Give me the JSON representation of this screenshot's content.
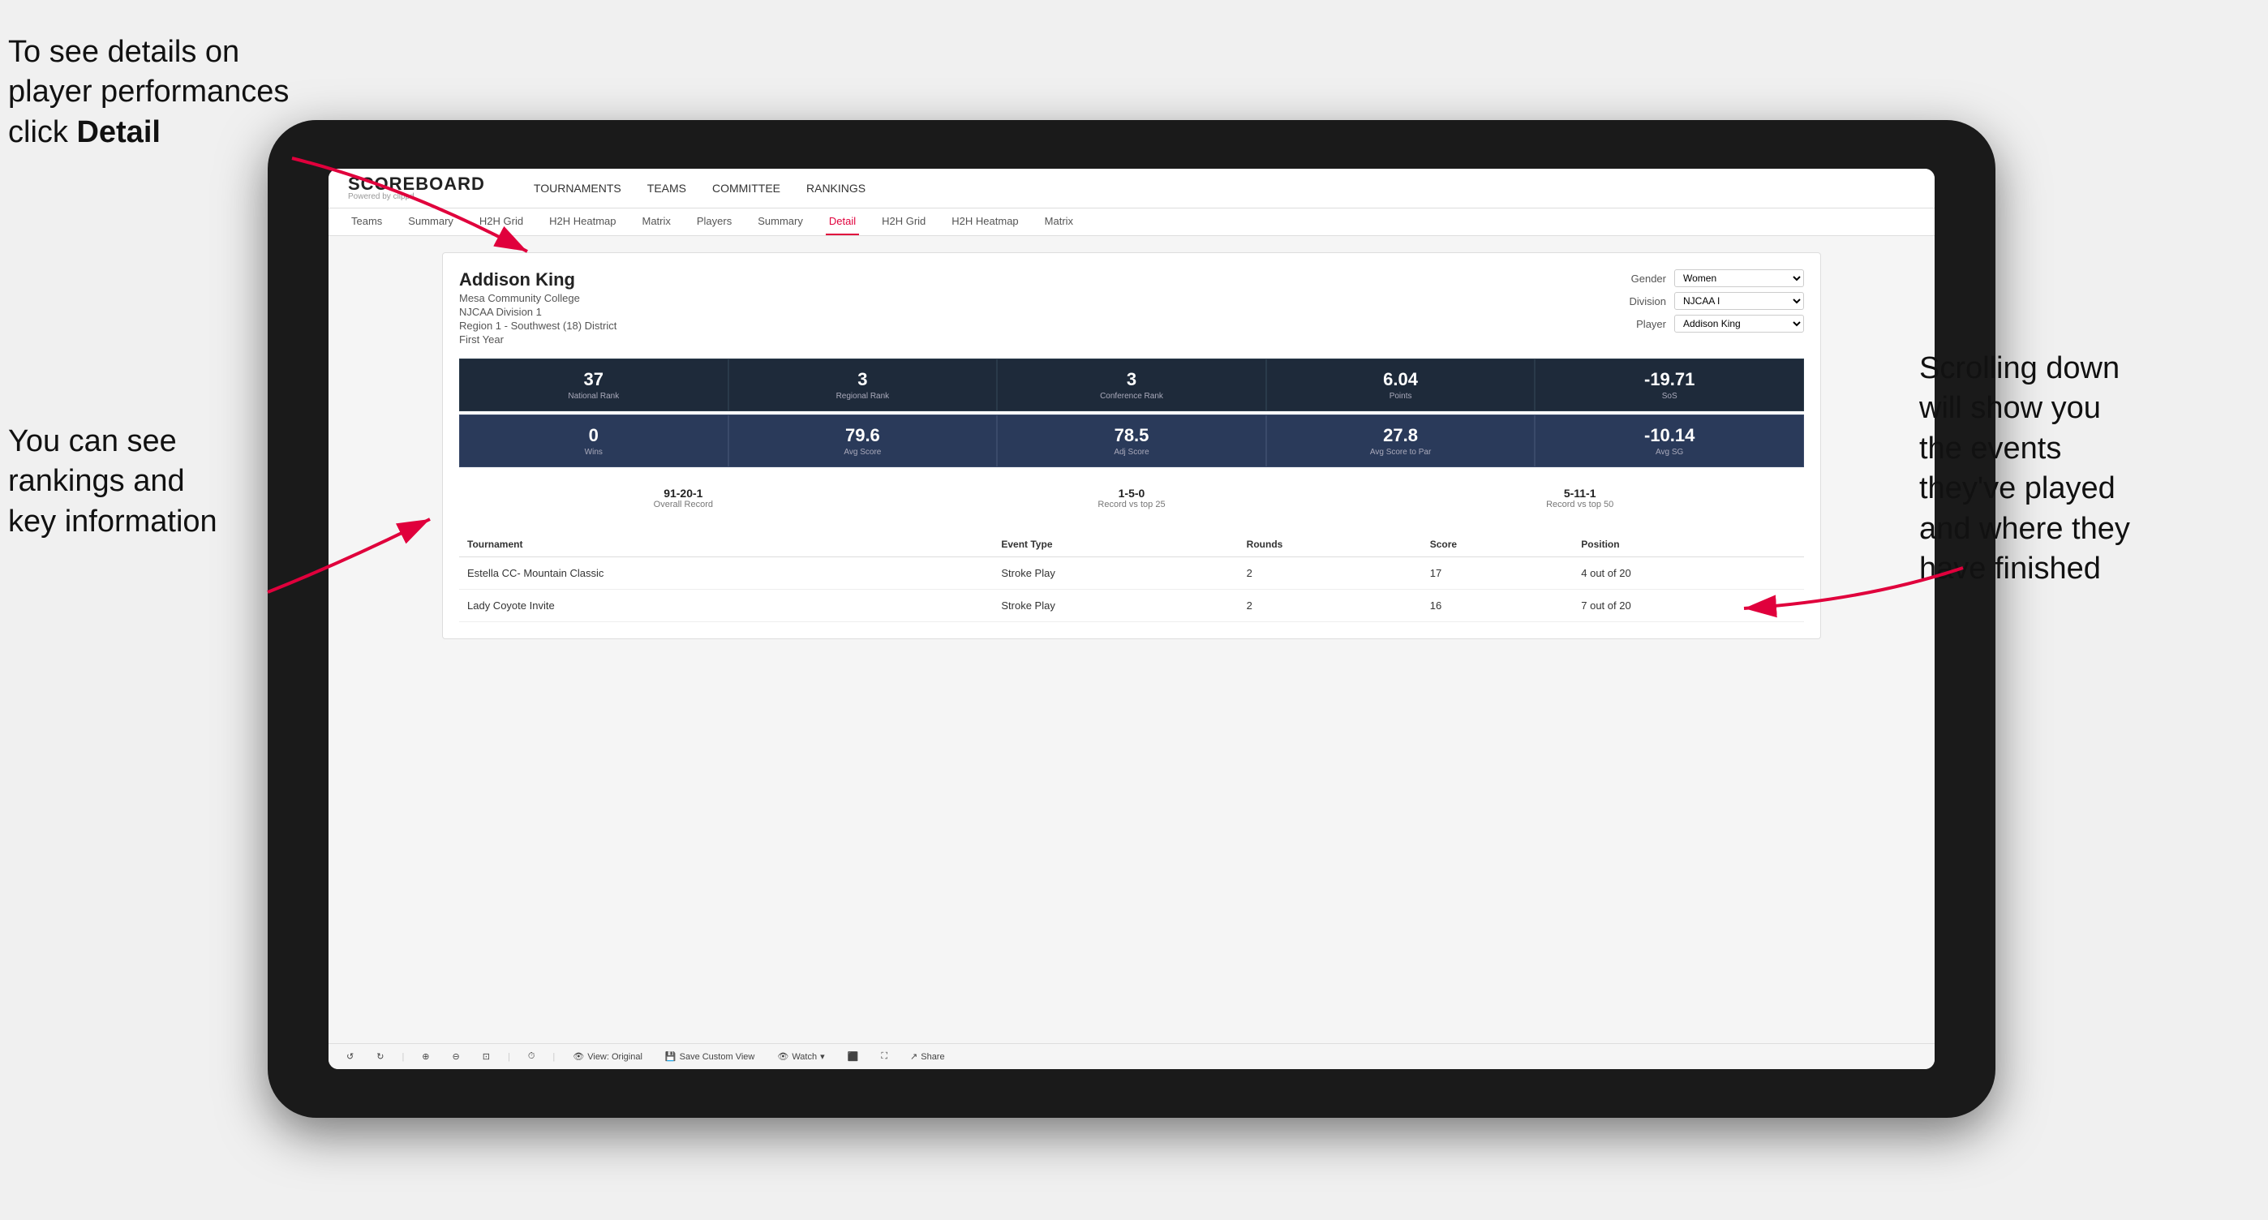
{
  "annotations": {
    "topleft": {
      "line1": "To see details on",
      "line2": "player performances",
      "line3_prefix": "click ",
      "line3_bold": "Detail"
    },
    "bottomleft": {
      "line1": "You can see",
      "line2": "rankings and",
      "line3": "key information"
    },
    "right": {
      "line1": "Scrolling down",
      "line2": "will show you",
      "line3": "the events",
      "line4": "they've played",
      "line5": "and where they",
      "line6": "have finished"
    }
  },
  "header": {
    "logo": "SCOREBOARD",
    "logo_sub": "Powered by clippd",
    "nav": [
      "TOURNAMENTS",
      "TEAMS",
      "COMMITTEE",
      "RANKINGS"
    ]
  },
  "sub_nav": {
    "tabs": [
      "Teams",
      "Summary",
      "H2H Grid",
      "H2H Heatmap",
      "Matrix",
      "Players",
      "Summary",
      "Detail",
      "H2H Grid",
      "H2H Heatmap",
      "Matrix"
    ],
    "active_tab": "Detail"
  },
  "player": {
    "name": "Addison King",
    "school": "Mesa Community College",
    "division": "NJCAA Division 1",
    "region": "Region 1 - Southwest (18) District",
    "year": "First Year"
  },
  "controls": {
    "gender_label": "Gender",
    "gender_options": [
      "Women"
    ],
    "gender_selected": "Women",
    "division_label": "Division",
    "division_options": [
      "NJCAA I"
    ],
    "division_selected": "NJCAA I",
    "player_label": "Player",
    "player_options": [
      "Addison King"
    ],
    "player_selected": "Addison King"
  },
  "stats_row1": [
    {
      "value": "37",
      "label": "National Rank"
    },
    {
      "value": "3",
      "label": "Regional Rank"
    },
    {
      "value": "3",
      "label": "Conference Rank"
    },
    {
      "value": "6.04",
      "label": "Points"
    },
    {
      "value": "-19.71",
      "label": "SoS"
    }
  ],
  "stats_row2": [
    {
      "value": "0",
      "label": "Wins"
    },
    {
      "value": "79.6",
      "label": "Avg Score"
    },
    {
      "value": "78.5",
      "label": "Adj Score"
    },
    {
      "value": "27.8",
      "label": "Avg Score to Par"
    },
    {
      "value": "-10.14",
      "label": "Avg SG"
    }
  ],
  "records": [
    {
      "value": "91-20-1",
      "label": "Overall Record"
    },
    {
      "value": "1-5-0",
      "label": "Record vs top 25"
    },
    {
      "value": "5-11-1",
      "label": "Record vs top 50"
    }
  ],
  "table": {
    "headers": [
      "Tournament",
      "Event Type",
      "Rounds",
      "Score",
      "Position"
    ],
    "rows": [
      {
        "tournament": "Estella CC- Mountain Classic",
        "event_type": "Stroke Play",
        "rounds": "2",
        "score": "17",
        "position": "4 out of 20"
      },
      {
        "tournament": "Lady Coyote Invite",
        "event_type": "Stroke Play",
        "rounds": "2",
        "score": "16",
        "position": "7 out of 20"
      }
    ]
  },
  "toolbar": {
    "undo_label": "↺",
    "redo_label": "↻",
    "view_original": "View: Original",
    "save_custom": "Save Custom View",
    "watch": "Watch",
    "share": "Share"
  }
}
